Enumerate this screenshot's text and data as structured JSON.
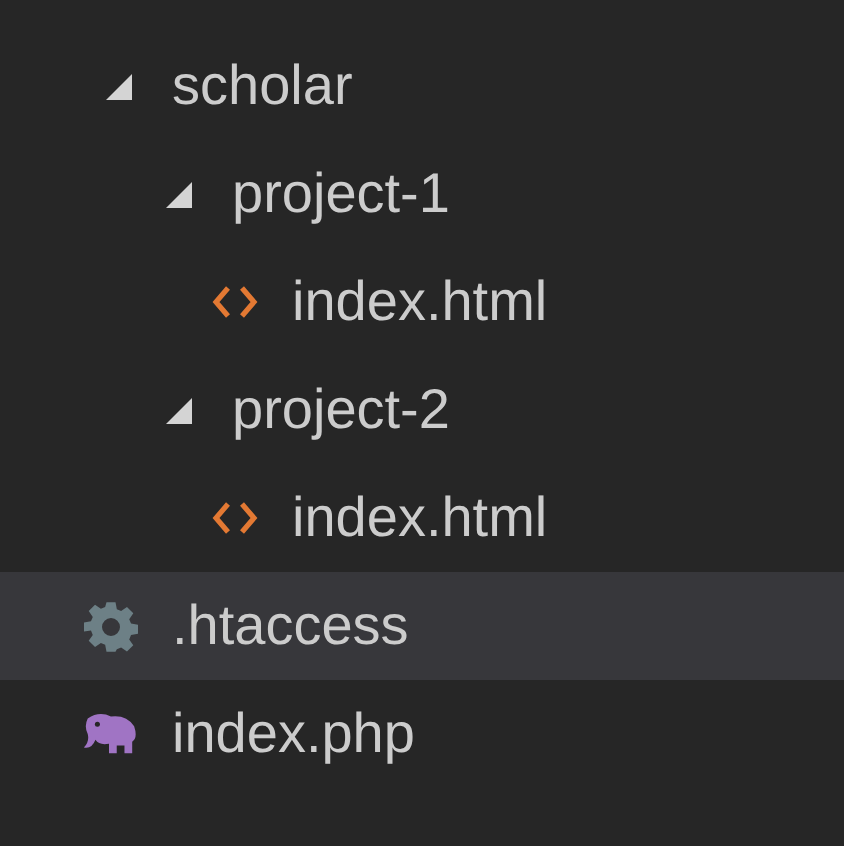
{
  "tree": [
    {
      "kind": "folder",
      "label": "scholar",
      "expanded": true,
      "selected": false,
      "children": [
        {
          "kind": "folder",
          "label": "project-1",
          "expanded": true,
          "selected": false,
          "children": [
            {
              "kind": "html",
              "label": "index.html",
              "selected": false
            }
          ]
        },
        {
          "kind": "folder",
          "label": "project-2",
          "expanded": true,
          "selected": false,
          "children": [
            {
              "kind": "html",
              "label": "index.html",
              "selected": false
            }
          ]
        }
      ]
    },
    {
      "kind": "config",
      "label": ".htaccess",
      "selected": true
    },
    {
      "kind": "php",
      "label": "index.php",
      "selected": false
    }
  ]
}
